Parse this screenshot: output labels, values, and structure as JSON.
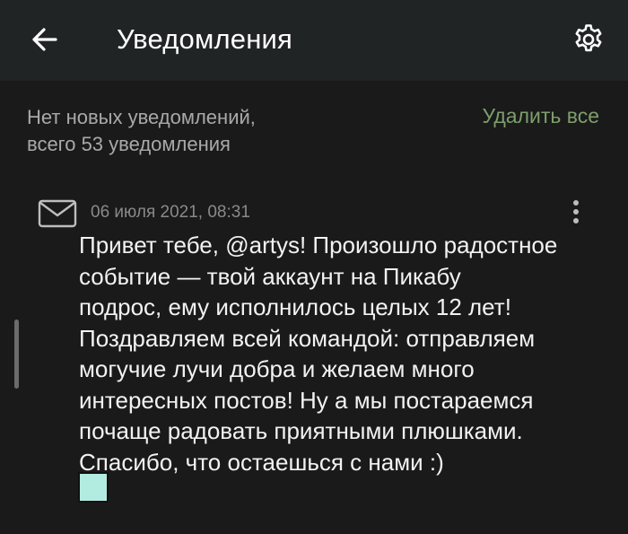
{
  "header": {
    "title": "Уведомления",
    "back_icon": "arrow-left-icon",
    "settings_icon": "gear-icon"
  },
  "summary": {
    "line1": "Нет новых уведомлений,",
    "line2": "всего 53 уведомления",
    "clear_all_label": "Удалить все"
  },
  "notification": {
    "icon": "envelope-icon",
    "date": "06 июля 2021, 08:31",
    "more_icon": "more-vertical-icon",
    "lines": [
      "Привет тебе, @artys! Произошло радостное",
      "событие — твой аккаунт на Пикабу",
      "подрос, ему исполнилось целых 12 лет!",
      "Поздравляем всей командой: отправляем",
      "могучие лучи добра и желаем много",
      "интересных постов! Ну а мы постараемся",
      "почаще радовать приятными плюшками.",
      "Спасибо, что остаешься с нами :)"
    ],
    "image_color": "#b2ece1"
  },
  "colors": {
    "background": "#1a1a1a",
    "header_background": "#202425",
    "accent_green": "#7e9e6c"
  }
}
